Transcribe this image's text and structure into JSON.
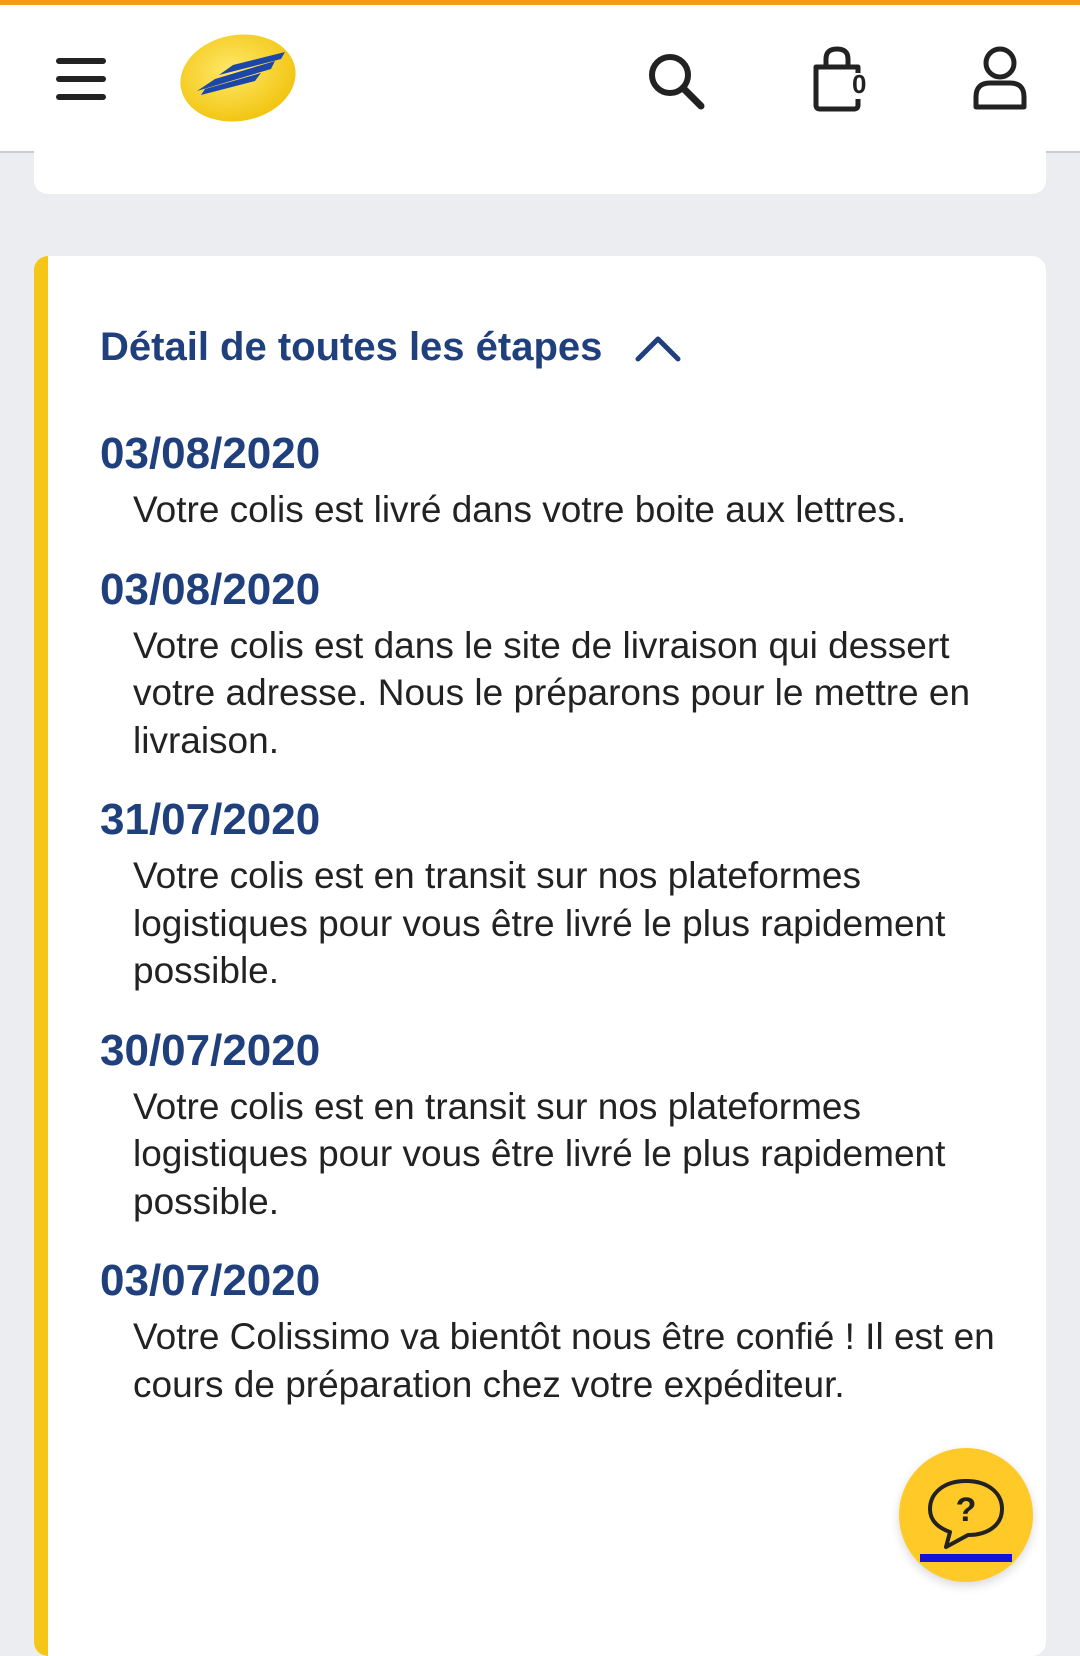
{
  "header": {
    "menu_icon": "hamburger-menu-icon",
    "logo": "la-poste-logo",
    "search_icon": "search-icon",
    "cart_icon": "shopping-bag-icon",
    "cart_count": "0",
    "account_icon": "user-icon"
  },
  "colors": {
    "top_accent": "#F39C12",
    "brand_blue": "#1F3F7D",
    "brand_yellow": "#F5C518",
    "help_yellow": "#FFC928"
  },
  "tracking": {
    "section_title": "Détail de toutes les étapes",
    "toggle_icon": "chevron-up-icon",
    "steps": [
      {
        "date": "03/08/2020",
        "text": "Votre colis est livré dans votre boite aux lettres."
      },
      {
        "date": "03/08/2020",
        "text": "Votre colis est dans le site de livraison qui dessert votre adresse. Nous le préparons pour le mettre en livraison."
      },
      {
        "date": "31/07/2020",
        "text": "Votre colis est en transit sur nos plateformes logistiques pour vous être livré le plus rapidement possible."
      },
      {
        "date": "30/07/2020",
        "text": "Votre colis est en transit sur nos plateformes logistiques pour vous être livré le plus rapidement possible."
      },
      {
        "date": "03/07/2020",
        "text": "Votre Colissimo va bientôt nous être confié ! Il est en cours de préparation chez votre expéditeur."
      }
    ]
  },
  "help": {
    "icon": "help-chat-icon",
    "glyph": "?"
  }
}
